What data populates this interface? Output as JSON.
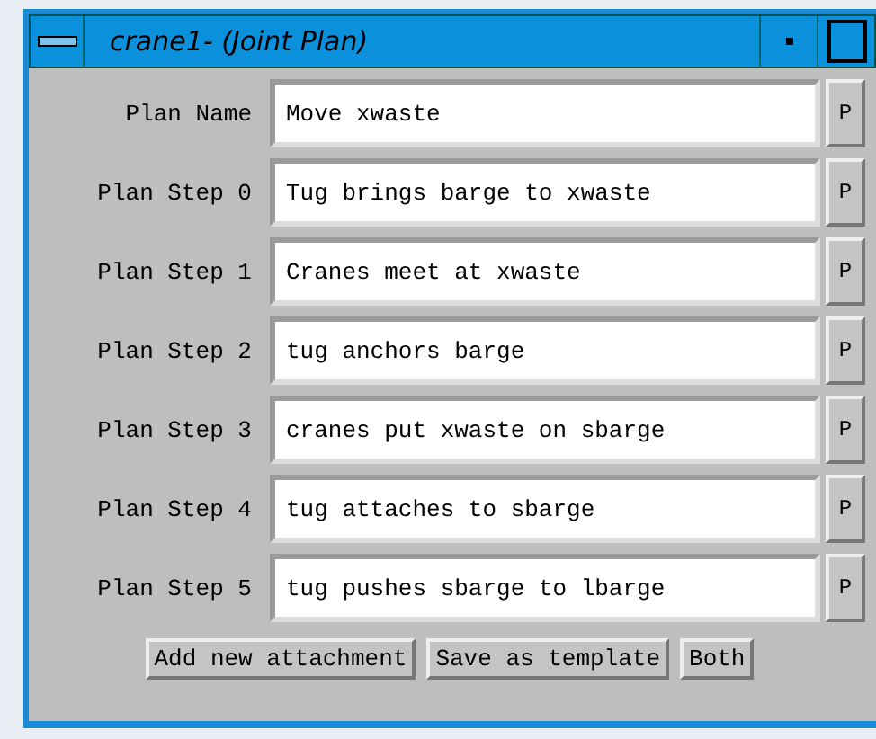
{
  "window": {
    "title": "crane1- (Joint Plan)"
  },
  "rows": [
    {
      "label": "Plan Name",
      "value": "Move xwaste",
      "button": "P"
    },
    {
      "label": "Plan Step 0",
      "value": "Tug brings barge to xwaste",
      "button": "P"
    },
    {
      "label": "Plan Step 1",
      "value": "Cranes meet at xwaste",
      "button": "P"
    },
    {
      "label": "Plan Step 2",
      "value": "tug anchors barge",
      "button": "P"
    },
    {
      "label": "Plan Step 3",
      "value": "cranes put xwaste on sbarge",
      "button": "P"
    },
    {
      "label": "Plan Step 4",
      "value": "tug attaches to sbarge",
      "button": "P"
    },
    {
      "label": "Plan Step 5",
      "value": "tug pushes sbarge to lbarge",
      "button": "P"
    }
  ],
  "buttons": [
    "Add new attachment",
    "Save as template",
    "Both"
  ]
}
